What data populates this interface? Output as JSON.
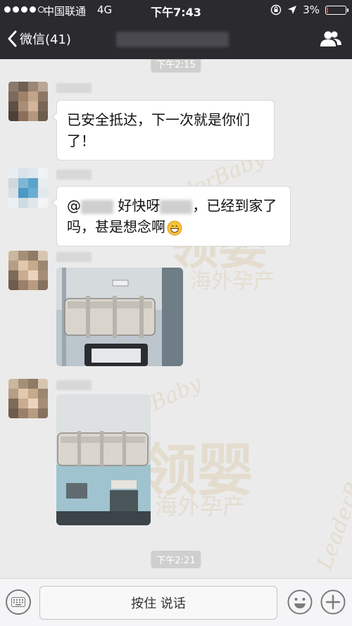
{
  "status_bar": {
    "carrier": "中国联通",
    "network": "4G",
    "time": "下午7:43",
    "battery": "3%",
    "battery_level": 0.03,
    "colors": {
      "battery_low": "#e53935"
    }
  },
  "nav": {
    "back_label": "微信(41)",
    "back_icon": "chevron-left-icon",
    "right_icon": "contacts-icon"
  },
  "chat": {
    "timestamps": [
      "下午2:15",
      "下午2:21"
    ],
    "messages": {
      "m1": {
        "text": "已安全抵达，下一次就是你们了！"
      },
      "m2": {
        "prefix": "@",
        "middle": " 好快呀",
        "suffix": "，已经到家了吗，甚是想念啊",
        "emoji": "grinning-face-icon"
      }
    },
    "watermark": {
      "brand": "LeaderBaby",
      "cn": "领婴",
      "tagline": "海外孕产"
    }
  },
  "input": {
    "talk_label": "按住 说话",
    "left_icon": "keyboard-icon",
    "emoji_icon": "emoji-icon",
    "plus_icon": "plus-icon"
  }
}
